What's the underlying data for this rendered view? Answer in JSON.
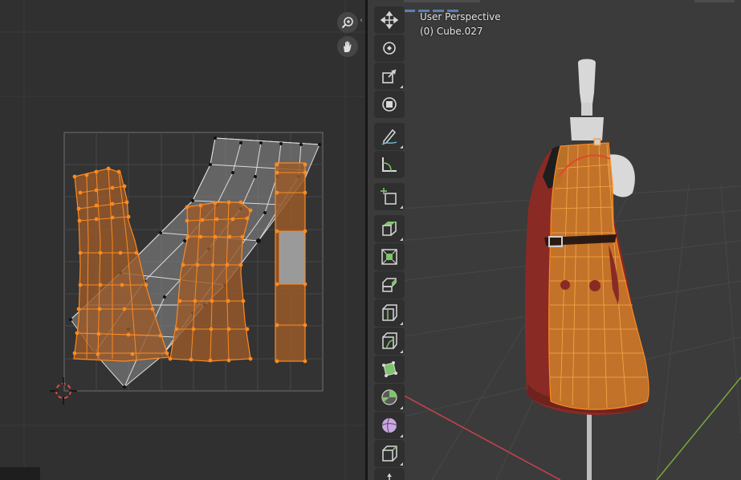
{
  "uv_editor": {
    "tools": {
      "zoom_icon": "zoom-icon",
      "pan_icon": "hand-icon"
    }
  },
  "viewport": {
    "view_name": "User Perspective",
    "object_name": "(0) Cube.027",
    "toolbar": [
      {
        "name": "move-tool",
        "icon": "move-icon"
      },
      {
        "name": "rotate-tool",
        "icon": "rotate-icon"
      },
      {
        "name": "scale-tool",
        "icon": "scale-icon"
      },
      {
        "name": "transform-tool",
        "icon": "transform-icon"
      },
      {
        "name": "annotate-tool",
        "icon": "annotate-icon"
      },
      {
        "name": "measure-tool",
        "icon": "measure-icon"
      },
      {
        "name": "add-cube-tool",
        "icon": "add-cube-icon"
      },
      {
        "name": "extrude-tool",
        "icon": "extrude-icon"
      },
      {
        "name": "inset-tool",
        "icon": "inset-icon"
      },
      {
        "name": "bevel-tool",
        "icon": "bevel-icon"
      },
      {
        "name": "loop-cut-tool",
        "icon": "loop-cut-icon"
      },
      {
        "name": "knife-tool",
        "icon": "knife-icon"
      },
      {
        "name": "poly-build-tool",
        "icon": "poly-build-icon"
      },
      {
        "name": "spin-tool",
        "icon": "spin-icon"
      },
      {
        "name": "smooth-tool",
        "icon": "smooth-icon"
      },
      {
        "name": "edge-slide-tool",
        "icon": "edge-slide-icon"
      },
      {
        "name": "shrink-fatten-tool",
        "icon": "shrink-fatten-icon"
      }
    ]
  },
  "colors": {
    "selection_orange": "#ff8a1f",
    "uv_face_fill": "#9a5a2a",
    "dress_red": "#8a2a25",
    "background_uv": "#303030",
    "background_viewport": "#3b3b3b",
    "x_axis": "#c8424f",
    "y_axis": "#7aa83a"
  }
}
